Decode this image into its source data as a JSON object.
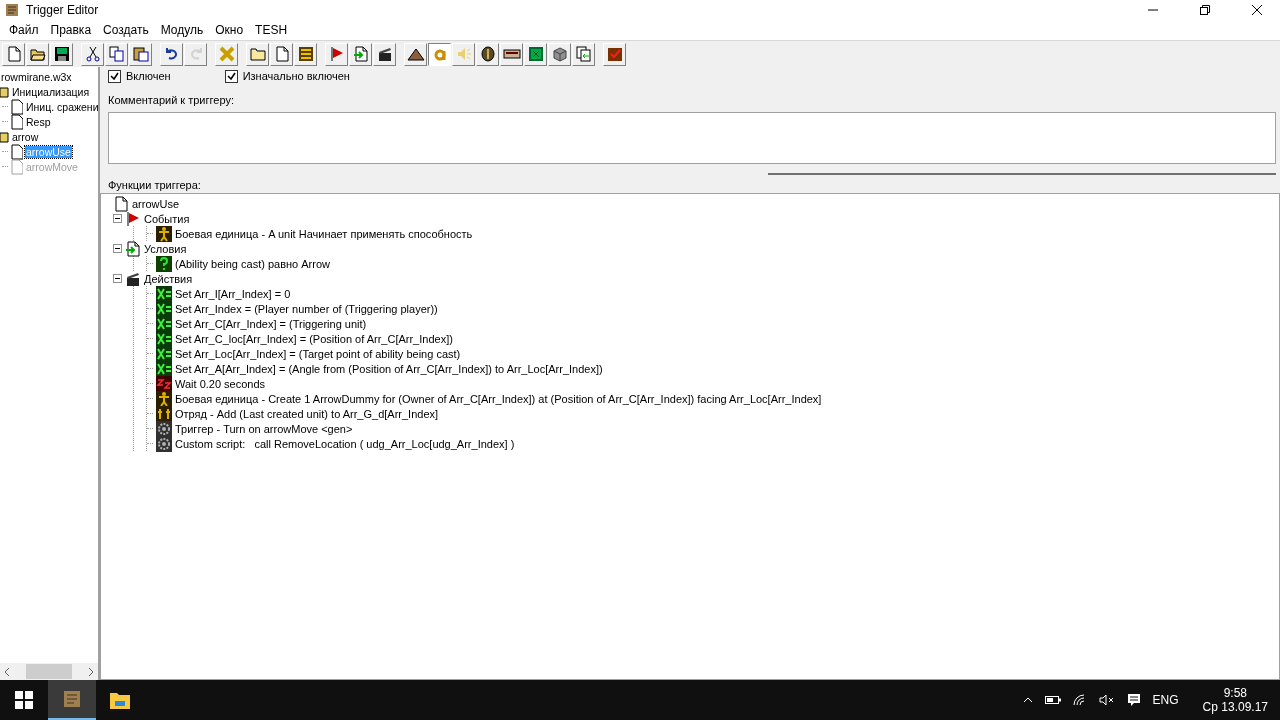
{
  "window": {
    "title": "Trigger Editor"
  },
  "menu": [
    "Файл",
    "Правка",
    "Создать",
    "Модуль",
    "Окно",
    "TESH"
  ],
  "toolbar": [
    [
      {
        "kind": "new",
        "disabled": false,
        "pressed": false
      },
      {
        "kind": "open",
        "disabled": false,
        "pressed": false
      },
      {
        "kind": "save",
        "disabled": false,
        "pressed": false
      }
    ],
    [
      {
        "kind": "cut",
        "disabled": false,
        "pressed": false
      },
      {
        "kind": "copy",
        "disabled": false,
        "pressed": false
      },
      {
        "kind": "paste",
        "disabled": false,
        "pressed": false
      }
    ],
    [
      {
        "kind": "undo",
        "disabled": false,
        "pressed": false
      },
      {
        "kind": "redo",
        "disabled": true,
        "pressed": false
      }
    ],
    [
      {
        "kind": "variables",
        "disabled": false,
        "pressed": false
      }
    ],
    [
      {
        "kind": "category",
        "disabled": false,
        "pressed": false
      },
      {
        "kind": "trigger",
        "disabled": false,
        "pressed": false
      },
      {
        "kind": "comment",
        "disabled": false,
        "pressed": false
      }
    ],
    [
      {
        "kind": "event",
        "disabled": false,
        "pressed": false
      },
      {
        "kind": "condition",
        "disabled": false,
        "pressed": false
      },
      {
        "kind": "action",
        "disabled": false,
        "pressed": false
      }
    ],
    [
      {
        "kind": "terrain",
        "disabled": false,
        "pressed": false
      },
      {
        "kind": "ability",
        "disabled": false,
        "pressed": true
      },
      {
        "kind": "sound",
        "disabled": false,
        "pressed": false
      },
      {
        "kind": "unit",
        "disabled": false,
        "pressed": false
      },
      {
        "kind": "panel",
        "disabled": false,
        "pressed": false
      },
      {
        "kind": "screen",
        "disabled": false,
        "pressed": false
      },
      {
        "kind": "object",
        "disabled": false,
        "pressed": false
      },
      {
        "kind": "import",
        "disabled": false,
        "pressed": false
      }
    ],
    [
      {
        "kind": "test",
        "disabled": false,
        "pressed": false
      }
    ]
  ],
  "sidebar": {
    "root": "rowmirane.w3x",
    "folders": [
      {
        "label": "Инициализация",
        "items": [
          {
            "label": "Иниц. сражени",
            "selected": false,
            "disabled": false
          },
          {
            "label": "Resp",
            "selected": false,
            "disabled": false
          }
        ]
      },
      {
        "label": "arrow",
        "items": [
          {
            "label": "arrowUse",
            "selected": true,
            "disabled": false
          },
          {
            "label": "arrowMove",
            "selected": false,
            "disabled": true
          }
        ]
      }
    ]
  },
  "options": [
    {
      "label": "Включен",
      "checked": true
    },
    {
      "label": "Изначально включен",
      "checked": true
    }
  ],
  "comment": {
    "label": "Комментарий к триггеру:"
  },
  "functions": {
    "label": "Функции триггера:",
    "root": "arrowUse",
    "sections": [
      {
        "kind": "events",
        "label": "События",
        "expanded": true,
        "children": [
          {
            "kind": "unit",
            "label": "Боевая единица - A unit Начинает применять способность"
          }
        ]
      },
      {
        "kind": "conditions",
        "label": "Условия",
        "expanded": true,
        "children": [
          {
            "kind": "question",
            "label": "(Ability being cast) равно Arrow"
          }
        ]
      },
      {
        "kind": "actions",
        "label": "Действия",
        "expanded": true,
        "children": [
          {
            "kind": "set",
            "label": "Set Arr_I[Arr_Index] = 0"
          },
          {
            "kind": "set",
            "label": "Set Arr_Index = (Player number of (Triggering player))"
          },
          {
            "kind": "set",
            "label": "Set Arr_C[Arr_Index] = (Triggering unit)"
          },
          {
            "kind": "set",
            "label": "Set Arr_C_loc[Arr_Index] = (Position of Arr_C[Arr_Index])"
          },
          {
            "kind": "set",
            "label": "Set Arr_Loc[Arr_Index] = (Target point of ability being cast)"
          },
          {
            "kind": "set",
            "label": "Set Arr_A[Arr_Index] = (Angle from (Position of Arr_C[Arr_Index]) to Arr_Loc[Arr_Index])"
          },
          {
            "kind": "wait",
            "label": "Wait 0.20 seconds"
          },
          {
            "kind": "unit",
            "label": "Боевая единица - Create 1 ArrowDummy for (Owner of Arr_C[Arr_Index]) at (Position of Arr_C[Arr_Index]) facing Arr_Loc[Arr_Index]"
          },
          {
            "kind": "group",
            "label": "Отряд - Add (Last created unit) to Arr_G_d[Arr_Index]"
          },
          {
            "kind": "gear",
            "label": "Триггер - Turn on arrowMove <gen>"
          },
          {
            "kind": "gear",
            "label": "Custom script:   call RemoveLocation ( udg_Arr_Loc[udg_Arr_Index] )"
          }
        ]
      }
    ]
  },
  "taskbar": {
    "language": "ENG",
    "time": "9:58",
    "date": "Ср 13.09.17"
  }
}
